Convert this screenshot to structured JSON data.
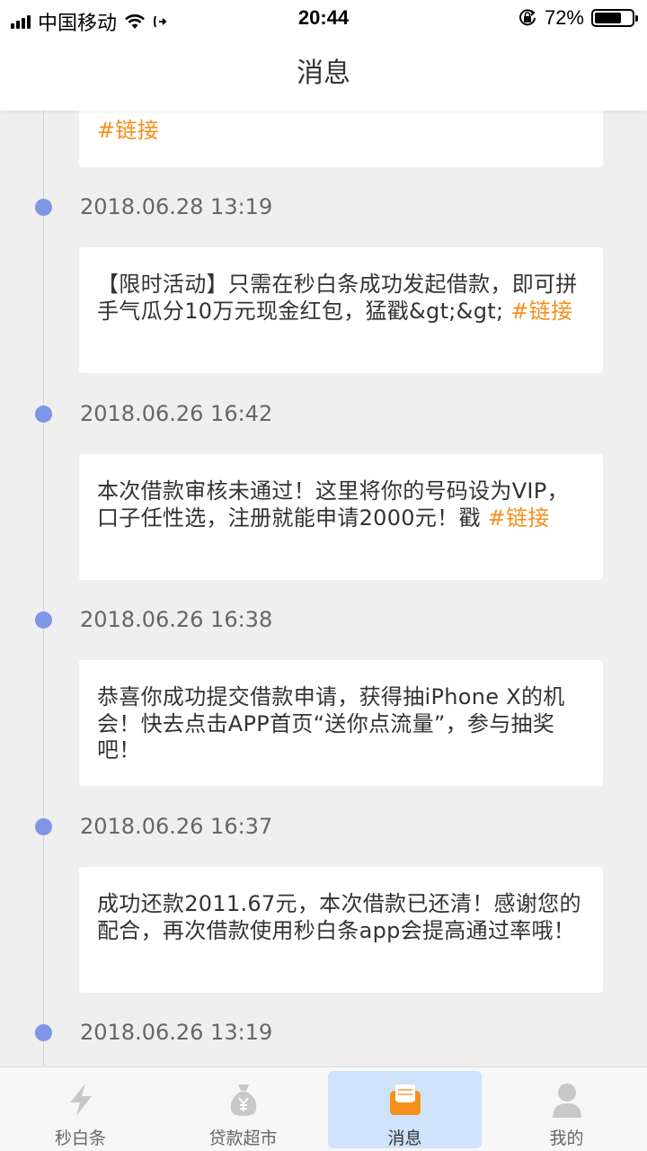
{
  "status_bar": {
    "carrier": "中国移动",
    "time": "20:44",
    "battery_text": "72%",
    "battery_level": 0.72
  },
  "header": {
    "title": "消息"
  },
  "messages": [
    {
      "date": "",
      "text": "",
      "link": "#链接"
    },
    {
      "date": "2018.06.28 13:19",
      "text": "【限时活动】只需在秒白条成功发起借款，即可拼手气瓜分10万元现金红包，猛戳&gt;&gt; ",
      "link": "#链接"
    },
    {
      "date": "2018.06.26 16:42",
      "text": "本次借款审核未通过！这里将你的号码设为VIP，口子任性选，注册就能申请2000元！戳 ",
      "link": "#链接"
    },
    {
      "date": "2018.06.26 16:38",
      "text": "恭喜你成功提交借款申请，获得抽iPhone X的机会！快去点击APP首页“送你点流量”，参与抽奖吧！",
      "link": ""
    },
    {
      "date": "2018.06.26 16:37",
      "text": "成功还款2011.67元，本次借款已还清！感谢您的配合，再次借款使用秒白条app会提高通过率哦！",
      "link": ""
    },
    {
      "date": "2018.06.26 13:19",
      "text": "",
      "link": ""
    }
  ],
  "tabs": [
    {
      "label": "秒白条",
      "icon": "lightning-icon",
      "active": false
    },
    {
      "label": "贷款超市",
      "icon": "money-bag-icon",
      "active": false
    },
    {
      "label": "消息",
      "icon": "mail-icon",
      "active": true
    },
    {
      "label": "我的",
      "icon": "user-icon",
      "active": false
    }
  ],
  "colors": {
    "accent_link": "#f5901b",
    "timeline_dot": "#7f96e6",
    "active_tab_bg": "#cfe3fb",
    "active_icon": "#f5901b",
    "inactive_icon": "#c8c8c8"
  }
}
